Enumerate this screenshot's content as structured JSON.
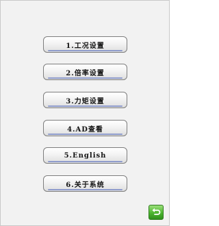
{
  "menu": {
    "items": [
      {
        "label": "1.工况设置"
      },
      {
        "label": "2.倍率设置"
      },
      {
        "label": "3.力矩设置"
      },
      {
        "label": "4.AD查看"
      },
      {
        "label": "5.English"
      },
      {
        "label": "6.关于系统"
      }
    ]
  },
  "back_button": {
    "icon": "return-arrow-icon",
    "color": "#4cb530"
  }
}
